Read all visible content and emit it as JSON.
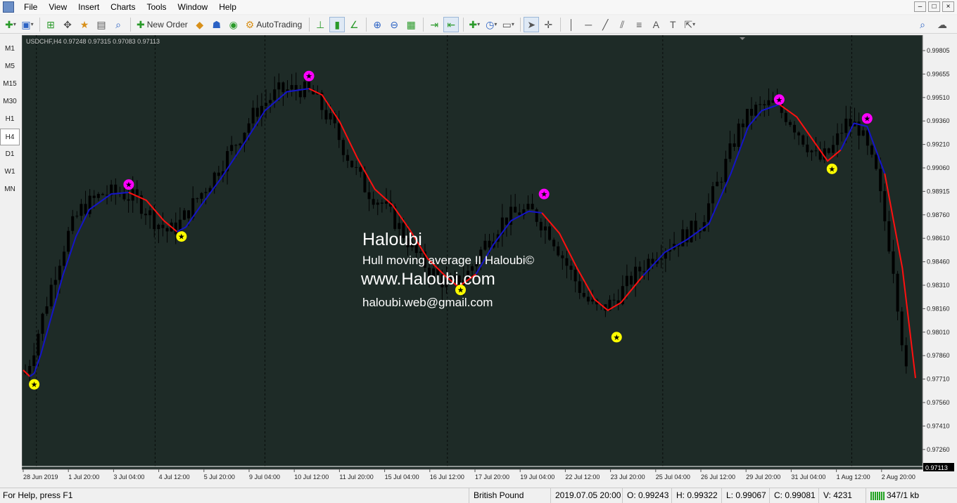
{
  "menu": [
    "File",
    "View",
    "Insert",
    "Charts",
    "Tools",
    "Window",
    "Help"
  ],
  "window_controls": [
    "–",
    "□",
    "×"
  ],
  "toolbar": {
    "new_order": "New Order",
    "autotrading": "AutoTrading"
  },
  "timeframes": [
    "M1",
    "M5",
    "M15",
    "M30",
    "H1",
    "H4",
    "D1",
    "W1",
    "MN"
  ],
  "active_timeframe": "H4",
  "chart": {
    "header": "USDCHF,H4  0.97248 0.97315 0.97083 0.97113",
    "bg": "#1e2b27",
    "candle_color": "#000000",
    "hull_up_color": "#1414c8",
    "hull_down_color": "#ff1010",
    "buy_marker_color": "#ffff00",
    "sell_marker_color": "#ff00ff",
    "watermark": {
      "title": "Haloubi",
      "line1": "Hull moving average II Haloubi©",
      "line2": "www.Haloubi.com",
      "line3": "haloubi.web@gmail.com"
    },
    "price_labels": [
      "0.99805",
      "0.99655",
      "0.99510",
      "0.99360",
      "0.99210",
      "0.99060",
      "0.98915",
      "0.98760",
      "0.98610",
      "0.98460",
      "0.98310",
      "0.98160",
      "0.98010",
      "0.97860",
      "0.97710",
      "0.97560",
      "0.97410",
      "0.97260"
    ],
    "current_price": "0.97113",
    "time_labels": [
      "28 Jun 2019",
      "1 Jul 20:00",
      "3 Jul 04:00",
      "4 Jul 12:00",
      "5 Jul 20:00",
      "9 Jul 04:00",
      "10 Jul 12:00",
      "11 Jul 20:00",
      "15 Jul 04:00",
      "16 Jul 12:00",
      "17 Jul 20:00",
      "19 Jul 04:00",
      "22 Jul 12:00",
      "23 Jul 20:00",
      "25 Jul 04:00",
      "26 Jul 12:00",
      "29 Jul 20:00",
      "31 Jul 04:00",
      "1 Aug 12:00",
      "2 Aug 20:00"
    ],
    "hull_line": [
      [
        0.9775,
        0
      ],
      [
        0.9771,
        0.03
      ],
      [
        0.9773,
        0.05
      ],
      [
        0.9785,
        0.08
      ],
      [
        0.9805,
        0.12
      ],
      [
        0.9835,
        0.18
      ],
      [
        0.986,
        0.24
      ],
      [
        0.9877,
        0.3
      ],
      [
        0.9887,
        0.4
      ],
      [
        0.9888,
        0.48
      ],
      [
        0.9883,
        0.56
      ],
      [
        0.987,
        0.64
      ],
      [
        0.9863,
        0.7
      ],
      [
        0.9866,
        0.74
      ],
      [
        0.9878,
        0.8
      ],
      [
        0.9897,
        0.9
      ],
      [
        0.9918,
        1.0
      ],
      [
        0.994,
        1.1
      ],
      [
        0.9952,
        1.2
      ],
      [
        0.9954,
        1.3
      ],
      [
        0.995,
        1.36
      ],
      [
        0.9933,
        1.44
      ],
      [
        0.991,
        1.52
      ],
      [
        0.989,
        1.6
      ],
      [
        0.988,
        1.68
      ],
      [
        0.9864,
        1.76
      ],
      [
        0.9846,
        1.84
      ],
      [
        0.9835,
        1.92
      ],
      [
        0.9828,
        1.98
      ],
      [
        0.9836,
        2.06
      ],
      [
        0.9855,
        2.14
      ],
      [
        0.987,
        2.22
      ],
      [
        0.9876,
        2.3
      ],
      [
        0.9875,
        2.36
      ],
      [
        0.9862,
        2.44
      ],
      [
        0.984,
        2.52
      ],
      [
        0.982,
        2.6
      ],
      [
        0.9813,
        2.66
      ],
      [
        0.9818,
        2.72
      ],
      [
        0.9835,
        2.82
      ],
      [
        0.985,
        2.92
      ],
      [
        0.9858,
        3.02
      ],
      [
        0.9868,
        3.12
      ],
      [
        0.99,
        3.22
      ],
      [
        0.993,
        3.3
      ],
      [
        0.994,
        3.36
      ],
      [
        0.9944,
        3.44
      ],
      [
        0.9936,
        3.52
      ],
      [
        0.992,
        3.6
      ],
      [
        0.9908,
        3.66
      ],
      [
        0.9915,
        3.72
      ],
      [
        0.9932,
        3.78
      ],
      [
        0.993,
        3.84
      ],
      [
        0.99,
        3.92
      ],
      [
        0.984,
        4.0
      ],
      [
        0.977,
        4.06
      ]
    ],
    "hull_segments": [
      [
        0,
        1,
        "down"
      ],
      [
        1,
        9,
        "up"
      ],
      [
        9,
        12,
        "down"
      ],
      [
        12,
        19,
        "up"
      ],
      [
        19,
        29,
        "down"
      ],
      [
        29,
        33,
        "up"
      ],
      [
        33,
        39,
        "down"
      ],
      [
        39,
        46,
        "up"
      ],
      [
        46,
        50,
        "down"
      ],
      [
        50,
        53,
        "up"
      ],
      [
        53,
        55,
        "down"
      ]
    ],
    "markers": [
      [
        "buy",
        0.9766,
        0.05
      ],
      [
        "sell",
        0.9893,
        0.48
      ],
      [
        "buy",
        0.986,
        0.72
      ],
      [
        "sell",
        0.9962,
        1.3
      ],
      [
        "buy",
        0.9826,
        1.99
      ],
      [
        "sell",
        0.9887,
        2.37
      ],
      [
        "buy",
        0.9796,
        2.7
      ],
      [
        "sell",
        0.9947,
        3.44
      ],
      [
        "buy",
        0.9903,
        3.68
      ],
      [
        "sell",
        0.9935,
        3.84
      ]
    ]
  },
  "status": {
    "help": "For Help, press F1",
    "symbol": "British Pound",
    "datetime": "2019.07.05 20:00",
    "open": "O: 0.99243",
    "high": "H: 0.99322",
    "low": "L: 0.99067",
    "close": "C: 0.99081",
    "volume": "V: 4231",
    "traffic": "347/1 kb"
  }
}
